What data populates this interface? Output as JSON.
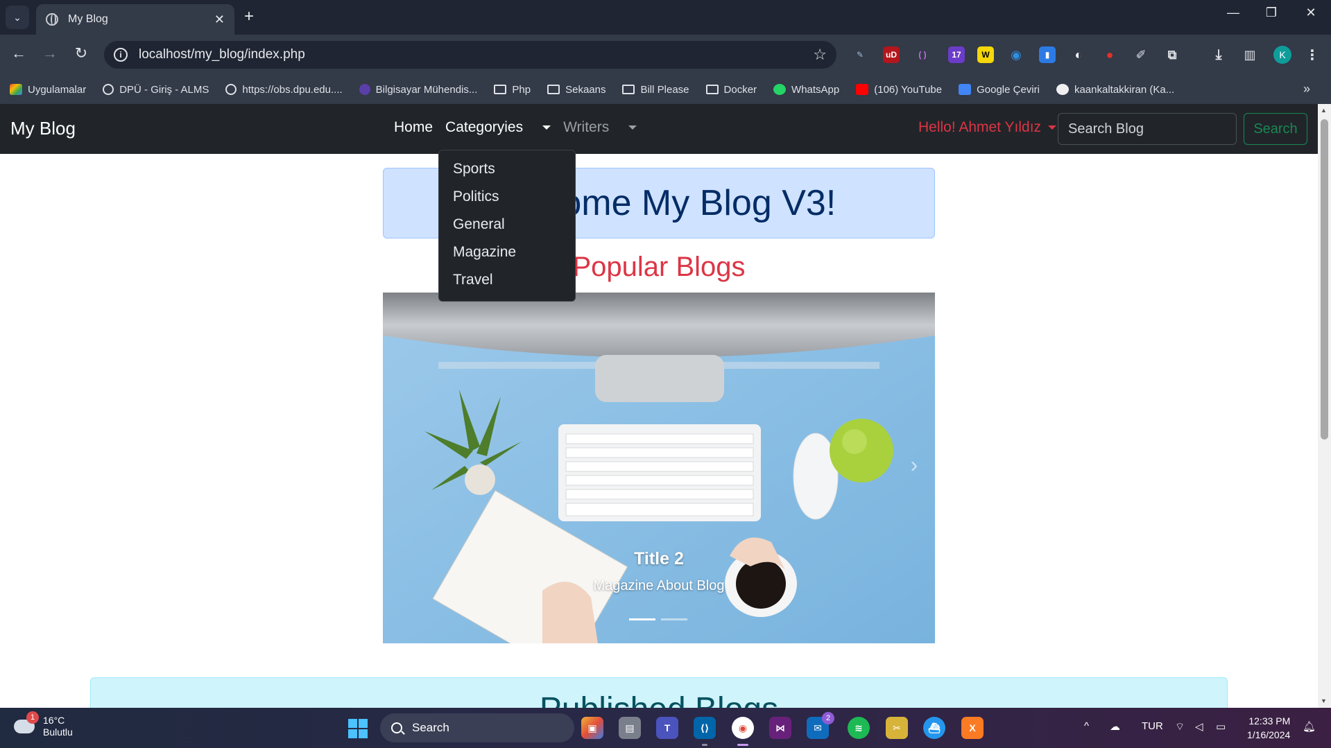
{
  "browser": {
    "tab_title": "My Blog",
    "url": "localhost/my_blog/index.php",
    "bookmarks": [
      "Uygulamalar",
      "DPÜ - Giriş - ALMS",
      "https://obs.dpu.edu....",
      "Bilgisayar Mühendis...",
      "Php",
      "Sekaans",
      "Bill Please",
      "Docker",
      "WhatsApp",
      "(106) YouTube",
      "Google Çeviri",
      "kaankaltakkiran (Ka..."
    ],
    "extension_badge": "17",
    "profile_initial": "K"
  },
  "site": {
    "brand": "My Blog",
    "nav": {
      "home": "Home",
      "categories": "Categoryies",
      "writers": "Writers"
    },
    "categories_menu": [
      "Sports",
      "Politics",
      "General",
      "Magazine",
      "Travel"
    ],
    "user_greeting": "Hello! Ahmet Yıldız",
    "search": {
      "placeholder": "Search Blog",
      "button": "Search"
    },
    "welcome_banner": "Welcome My Blog V3!",
    "popular_heading": "Popular Blogs",
    "carousel": {
      "slide_title": "Title 2",
      "slide_text": "Magazine About Blog",
      "indicator_count": 2,
      "active_indicator": 1
    },
    "published_heading": "Published Blogs"
  },
  "taskbar": {
    "weather_temp": "16°C",
    "weather_desc": "Bulutlu",
    "weather_badge": "1",
    "search_label": "Search",
    "mail_badge": "2",
    "language": "TUR",
    "time": "12:33 PM",
    "date": "1/16/2024"
  },
  "colors": {
    "navbar_bg": "#212529",
    "greeting": "#dc3545",
    "search_button": "#198754",
    "welcome_bg": "#cfe2ff",
    "welcome_text": "#052c65",
    "popular_heading": "#dc3545",
    "published_bg": "#cff4fc"
  }
}
